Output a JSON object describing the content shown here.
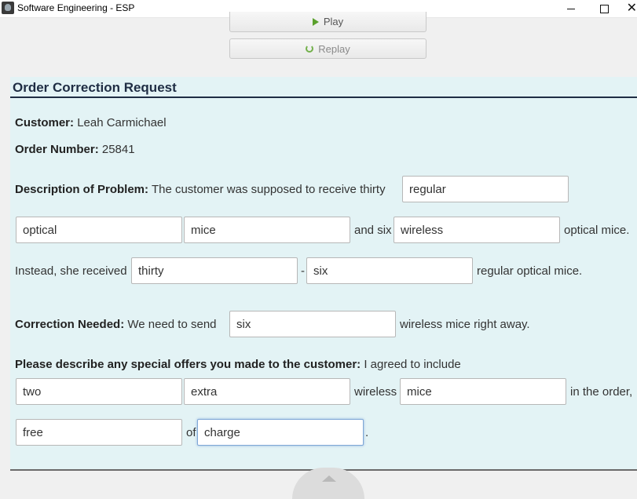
{
  "window": {
    "title": "Software Engineering - ESP"
  },
  "controls": {
    "play_label": "Play",
    "replay_label": "Replay"
  },
  "form": {
    "title": "Order Correction Request",
    "customer_label": "Customer:",
    "customer_value": "Leah Carmichael",
    "order_label": "Order Number:",
    "order_value": "25841",
    "description_label": "Description of Problem:",
    "description_lead": "The customer was supposed to receive thirty",
    "fields": {
      "f1": "regular",
      "f2": "optical",
      "f3": "mice",
      "f4": "wireless",
      "f5": "thirty",
      "f6": "six",
      "f7": "six",
      "f8": "two",
      "f9": "extra",
      "f10": "mice",
      "f11": "free",
      "f12": "charge"
    },
    "and_six": "and six",
    "optical_mice": "optical mice.",
    "instead": "Instead, she received",
    "dash": "-",
    "regular_optical_mice": "regular optical mice.",
    "correction_label": "Correction Needed:",
    "correction_lead": "We need to send",
    "correction_tail": "wireless mice right away.",
    "offers_label": "Please describe any special offers you made to the customer:",
    "offers_lead": "I agreed to include",
    "wireless": "wireless",
    "in_the_order": "in the order,",
    "of_word": "of",
    "period": "."
  }
}
